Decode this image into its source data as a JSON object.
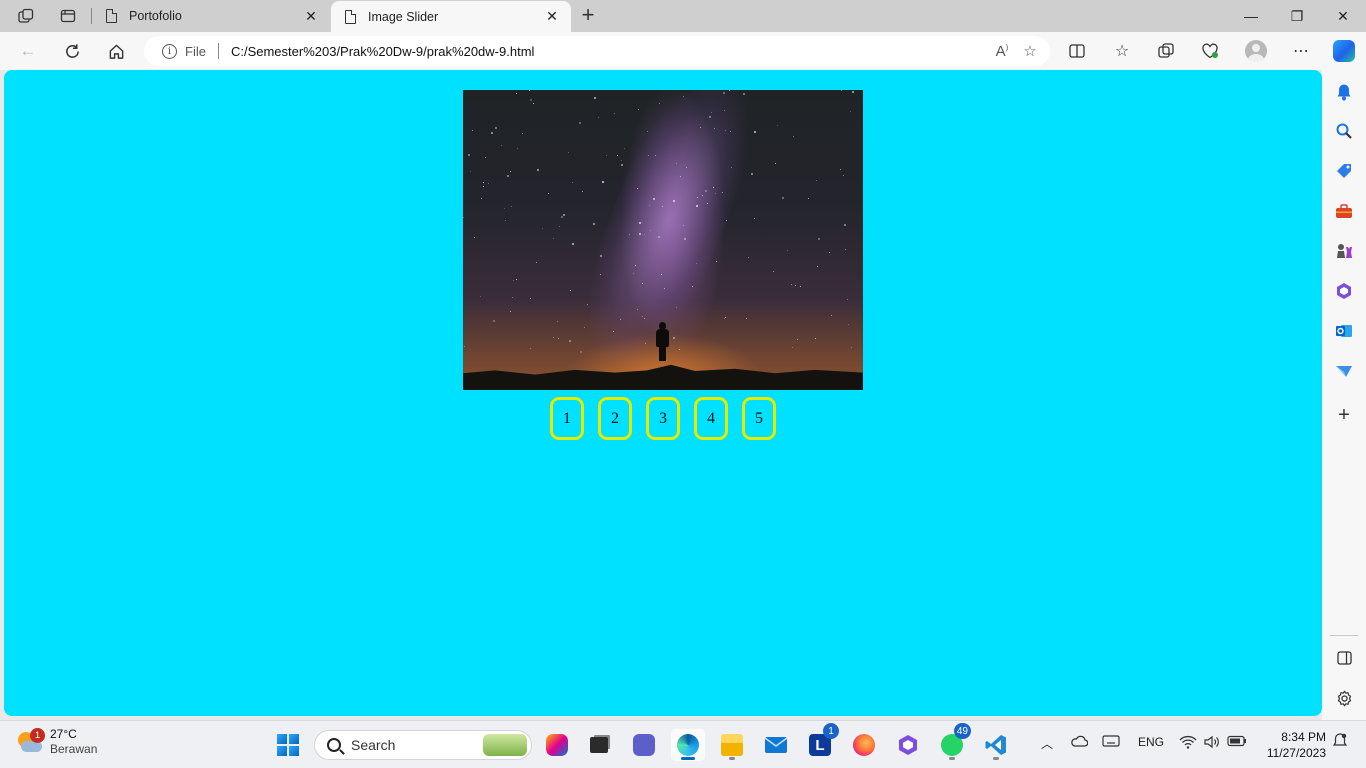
{
  "browser": {
    "tabs": [
      {
        "title": "Portofolio",
        "active": false
      },
      {
        "title": "Image Slider",
        "active": true
      }
    ],
    "new_tab_glyph": "+",
    "window_controls": {
      "minimize": "—",
      "maximize": "❐",
      "close": "✕"
    },
    "address": {
      "scheme_label": "File",
      "url": "C:/Semester%203/Prak%20Dw-9/prak%20dw-9.html"
    }
  },
  "page": {
    "background_color": "#00e1ff",
    "slide_image_alt": "Milky Way night sky",
    "slider_buttons": [
      "1",
      "2",
      "3",
      "4",
      "5"
    ],
    "button_border_color": "#e4ea00"
  },
  "taskbar": {
    "weather": {
      "temp": "27°C",
      "desc": "Berawan",
      "badge": "1"
    },
    "search_placeholder": "Search",
    "badges": {
      "mail_l": "1",
      "whatsapp": "49"
    },
    "lang": "ENG",
    "time": "8:34 PM",
    "date": "11/27/2023"
  }
}
